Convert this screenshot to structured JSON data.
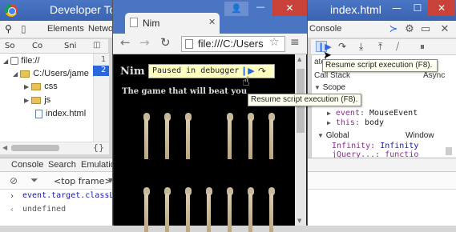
{
  "devtools": {
    "title": "Developer To",
    "title_tail": "index.html",
    "tabs": {
      "elements": "Elements",
      "network": "Netwo",
      "console": "Console"
    },
    "nav_tabs": [
      "So",
      "Co",
      "Sni"
    ],
    "tree": {
      "root": "file://",
      "path": "C:/Users/jame",
      "folder_css": "css",
      "folder_js": "js",
      "file": "index.html"
    },
    "lines": [
      "1",
      "2"
    ],
    "pretty_print": "{}"
  },
  "right_panel": {
    "watch_partial": "atch",
    "call_stack_partial": "Call Stack",
    "async": "Async",
    "scope_label": "Scope",
    "event_key": "event:",
    "event_val": "MouseEvent",
    "this_key": "this:",
    "this_val": "body",
    "global_label": "Global",
    "global_val": "Window",
    "infinity_key": "Infinity:",
    "infinity_val": "Infinity",
    "jquery_partial": "jQuery...: functio",
    "tooltip": "Resume script execution (F8)."
  },
  "drawer": {
    "tabs": [
      "Console",
      "Search",
      "Emulatio"
    ],
    "frame": "<top frame>",
    "command": "event.target.classL",
    "result": "undefined"
  },
  "browser": {
    "tab_title": "Nim",
    "url": "file:///C:/Users",
    "page_title": "Nim",
    "page_subtitle": "The game that will beat you",
    "paused_text": "Paused in debugger",
    "tooltip": "Resume script execution (F8)."
  }
}
